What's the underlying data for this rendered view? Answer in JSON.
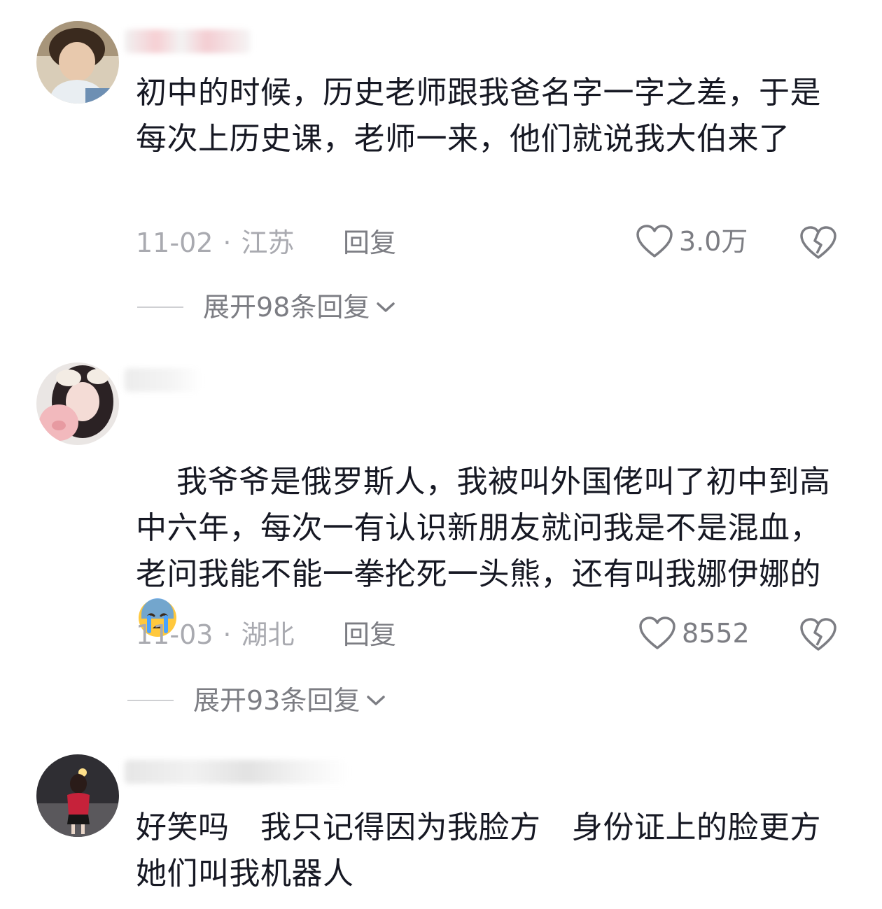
{
  "comments": [
    {
      "avatar": "avatar-boy-photo",
      "text": "初中的时候，历史老师跟我爸名字一字之差，于是每次上历史课，老师一来，他们就说我大伯来了",
      "date": "11-02",
      "location": "江苏",
      "reply_label": "回复",
      "likes": "3.0万",
      "expand_label": "展开98条回复"
    },
    {
      "avatar": "avatar-girl-photo",
      "text": "我爷爷是俄罗斯人，我被叫外国佬叫了初中到高中六年，每次一有认识新朋友就问我是不是混血，老问我能不能一拳抡死一头熊，还有叫我娜伊娜的",
      "emoji": "crying-face-emoji",
      "date": "11-03",
      "location": "湖北",
      "reply_label": "回复",
      "likes": "8552",
      "expand_label": "展开93条回复"
    },
    {
      "avatar": "avatar-night-photo",
      "text": "好笑吗　我只记得因为我脸方　身份证上的脸更方她们叫我机器人"
    }
  ],
  "separator": "·",
  "colors": {
    "text_primary": "#161823",
    "text_secondary": "#a9aab0",
    "text_action": "#7c7d83",
    "background": "#ffffff"
  },
  "icons": {
    "like": "heart-outline-icon",
    "dislike": "broken-heart-icon",
    "expand": "chevron-down-icon"
  }
}
